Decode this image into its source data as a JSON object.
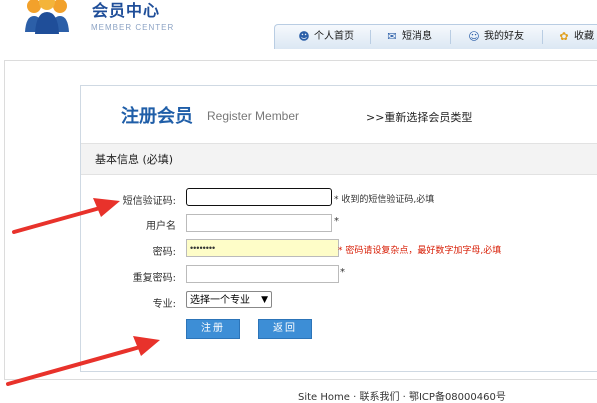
{
  "header": {
    "title": "会员中心",
    "subtitle": "MEMBER CENTER"
  },
  "nav": [
    {
      "label": "个人首页",
      "icon": "user-icon"
    },
    {
      "label": "短消息",
      "icon": "message-icon"
    },
    {
      "label": "我的好友",
      "icon": "friends-icon"
    },
    {
      "label": "收藏",
      "icon": "favorite-icon"
    }
  ],
  "page": {
    "title": "注册会员",
    "title_en": "Register Member",
    "reselect": ">>重新选择会员类型"
  },
  "section": {
    "title": "基本信息 (必填)"
  },
  "form": {
    "sms_code": {
      "label": "短信验证码:",
      "value": "",
      "hint": "* 收到的短信验证码,必填"
    },
    "username": {
      "label": "用户名",
      "value": "",
      "hint": "*"
    },
    "password": {
      "label": "密码:",
      "value": "••••••••",
      "hint": "* 密码请设复杂点，最好数字加字母,必填"
    },
    "password_confirm": {
      "label": "重复密码:",
      "value": "",
      "hint": "*"
    },
    "major": {
      "label": "专业:",
      "selected": "选择一个专业"
    }
  },
  "buttons": {
    "register": "注册",
    "back": "返回"
  },
  "footer": {
    "text": "Site Home · 联系我们 · 鄂ICP备08000460号"
  },
  "colors": {
    "brand": "#1f5ea8",
    "button": "#3d8ed6",
    "hint_red": "#d81e06",
    "arrow": "#e8322b"
  }
}
